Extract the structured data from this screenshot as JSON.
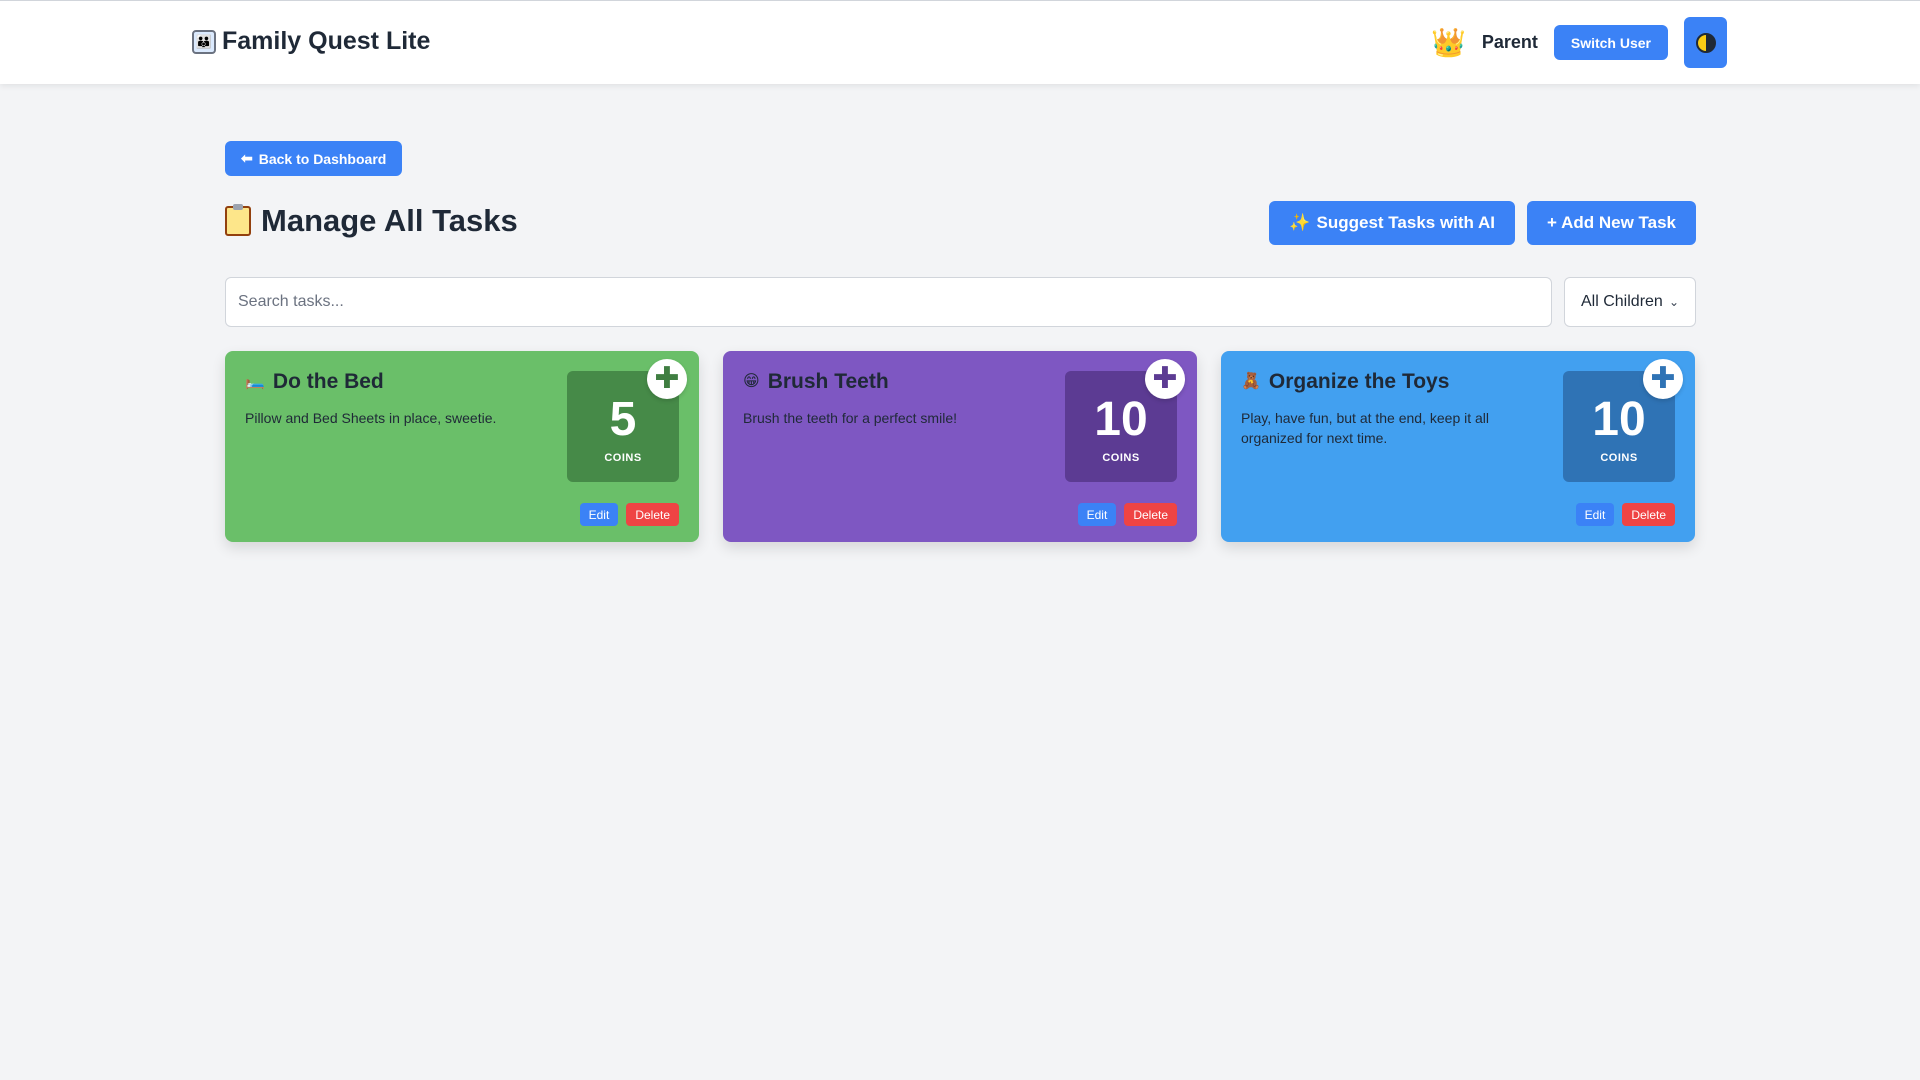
{
  "app": {
    "title": "Family Quest Lite",
    "logo_icon": "family-icon"
  },
  "header": {
    "user_icon": "crown-icon",
    "user_name": "Parent",
    "switch_user_label": "Switch User",
    "theme_toggle_icon": "half-moon-icon"
  },
  "nav": {
    "back_label": "Back to Dashboard",
    "back_icon": "back-arrow-icon"
  },
  "page": {
    "title": "Manage All Tasks",
    "title_icon": "clipboard-icon",
    "suggest_label": "Suggest Tasks with AI",
    "suggest_icon": "sparkles-icon",
    "add_label": "+ Add New Task"
  },
  "filters": {
    "search_placeholder": "Search tasks...",
    "search_value": "",
    "child_filter_selected": "All Children"
  },
  "tasks": [
    {
      "icon": "bed-icon",
      "title": "Do the Bed",
      "description": "Pillow and Bed Sheets in place, sweetie.",
      "coins": "5",
      "coins_label": "COINS",
      "edit_label": "Edit",
      "delete_label": "Delete",
      "bg_color": "#6abf69",
      "coin_bg": "#468a48",
      "plus_color": "#3f7e41"
    },
    {
      "icon": "grin-face-icon",
      "title": "Brush Teeth",
      "description": "Brush the teeth for a perfect smile!",
      "coins": "10",
      "coins_label": "COINS",
      "edit_label": "Edit",
      "delete_label": "Delete",
      "bg_color": "#7e57c2",
      "coin_bg": "#5c3b93",
      "plus_color": "#5c3b93"
    },
    {
      "icon": "teddy-bear-icon",
      "title": "Organize the Toys",
      "description": "Play, have fun, but at the end, keep it all organized for next time.",
      "coins": "10",
      "coins_label": "COINS",
      "edit_label": "Edit",
      "delete_label": "Delete",
      "bg_color": "#42a0f0",
      "coin_bg": "#2f73b5",
      "plus_color": "#2f73b5"
    }
  ],
  "colors": {
    "primary": "#3b82f6",
    "danger": "#ef4444",
    "background": "#f3f4f6"
  }
}
